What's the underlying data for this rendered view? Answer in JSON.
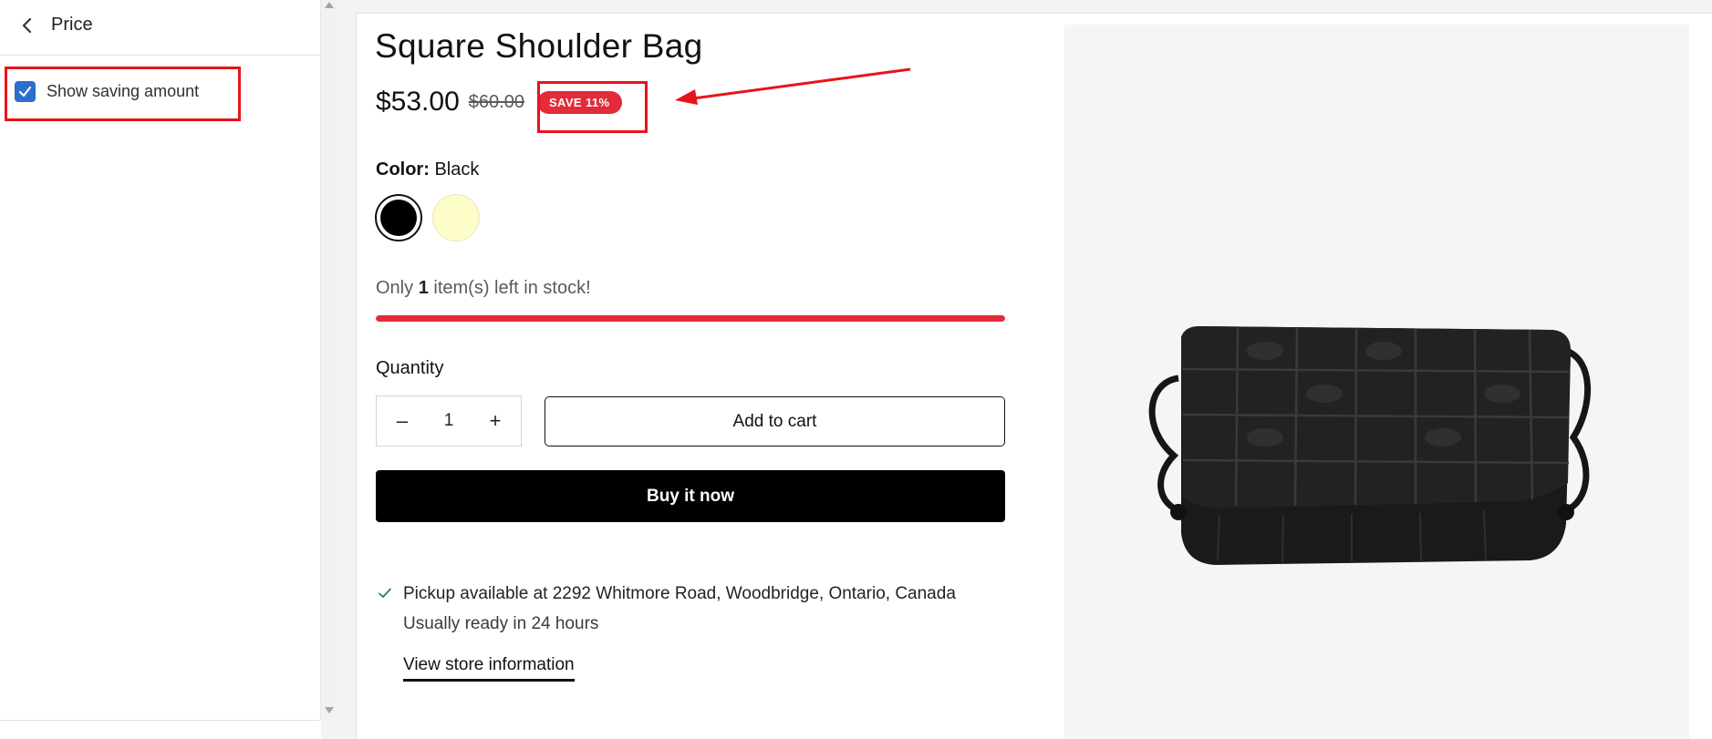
{
  "sidebar": {
    "title": "Price",
    "back_icon": "chevron-left-icon",
    "setting": {
      "label": "Show saving amount",
      "checked": true
    }
  },
  "product": {
    "title": "Square Shoulder Bag",
    "price": "$53.00",
    "compare_price": "$60.00",
    "save_badge": "SAVE 11%",
    "color_label": "Color:",
    "color_value": "Black",
    "swatches": [
      {
        "name": "Black",
        "color": "#000000",
        "selected": true
      },
      {
        "name": "Cream",
        "color": "#fdfdc9",
        "selected": false
      }
    ],
    "stock": {
      "prefix": "Only ",
      "count": "1",
      "suffix": " item(s) left in stock!",
      "level": 1.0
    },
    "quantity_label": "Quantity",
    "quantity_value": "1",
    "minus_label": "–",
    "plus_label": "+",
    "add_to_cart_label": "Add to cart",
    "buy_now_label": "Buy it now",
    "pickup_text": "Pickup available at 2292 Whitmore Road, Woodbridge, Ontario, Canada",
    "ready_text": "Usually ready in 24 hours",
    "store_link_text": "View store information"
  },
  "colors": {
    "accent_red": "#e32b3a",
    "checkbox_blue": "#2c6ecb",
    "annotation_red": "#e8141b"
  }
}
